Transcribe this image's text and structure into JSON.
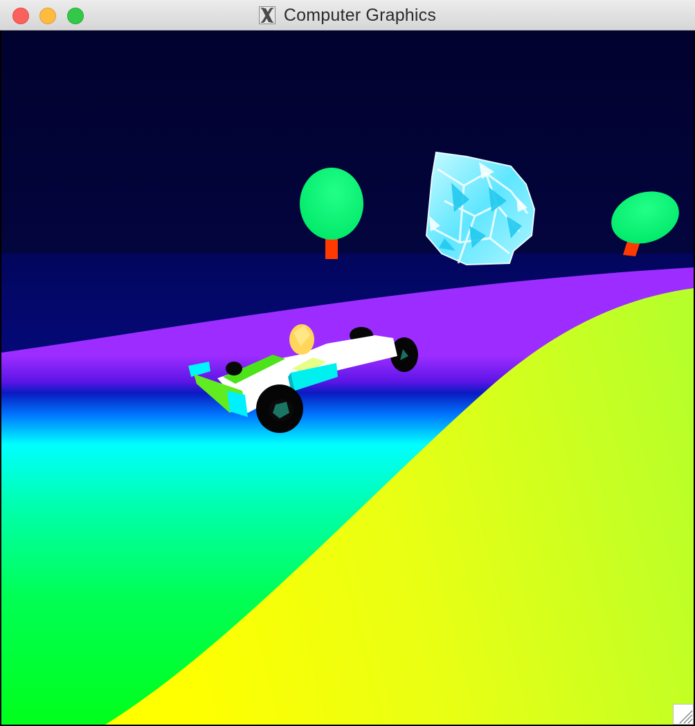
{
  "window": {
    "title": "Computer Graphics",
    "app_icon": "x11-icon"
  },
  "controls": {
    "close": "close-button",
    "minimize": "minimize-button",
    "zoom": "zoom-button"
  },
  "scene": {
    "objects": [
      "race-car",
      "crystal-rock",
      "tree",
      "tree",
      "rainbow-track",
      "yellow-terrain"
    ]
  },
  "colors": {
    "sky": "#02043a",
    "horizon": "#030777",
    "track_purple": "#8a26ff",
    "track_cyan": "#00ffff",
    "grass_green": "#00ff2a",
    "terrain_yellow": "#f7ff00",
    "tree_foliage": "#00f06a",
    "tree_trunk": "#ff3a00",
    "crystal": "#8ef4ff"
  }
}
